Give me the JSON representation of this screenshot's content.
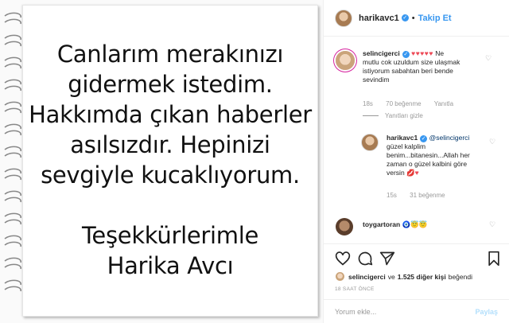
{
  "post": {
    "note_lines": [
      "Canlarım merakınızı",
      "gidermek istedim.",
      "Hakkımda çıkan haberler",
      "asılsızdır. Hepinizi",
      "sevgiyle kucaklıyorum."
    ],
    "sign_lines": [
      "Teşekkürlerimle",
      "Harika Avcı"
    ]
  },
  "header": {
    "username": "harikavc1",
    "separator": "•",
    "follow_label": "Takip Et"
  },
  "comments": [
    {
      "username": "selincigerci",
      "text_lines": [
        "Ne",
        "mutlu cok uzuldum size ulaşmak",
        "istiyorum sabahtan beri bende",
        "sevindim"
      ],
      "emoji": "♥♥♥♥♥",
      "time": "18s",
      "likes": "70 beğenme",
      "reply": "Yanıtla",
      "hide_replies": "Yanıtları gizle"
    },
    {
      "username": "harikavc1",
      "mention": "@selincigerci",
      "text_lines": [
        "güzel kalplim",
        "benim...bitanesin...Allah her",
        "zaman o güzel kalbini göre",
        "versin"
      ],
      "emoji": "💋♥",
      "time": "15s",
      "likes": "31 beğenme"
    },
    {
      "username": "toygartoran",
      "emoji": "🧿😇😇"
    }
  ],
  "likes": {
    "first_user": "selincigerci",
    "connector": "ve",
    "others": "1.525 diğer kişi",
    "suffix": "beğendi"
  },
  "timestamp": "18 SAAT ÖNCE",
  "add_comment": {
    "placeholder": "Yorum ekle...",
    "post_label": "Paylaş"
  },
  "colors": {
    "accent_blue": "#3897f0",
    "heart_red": "#ed4956",
    "muted_text": "#999999"
  }
}
